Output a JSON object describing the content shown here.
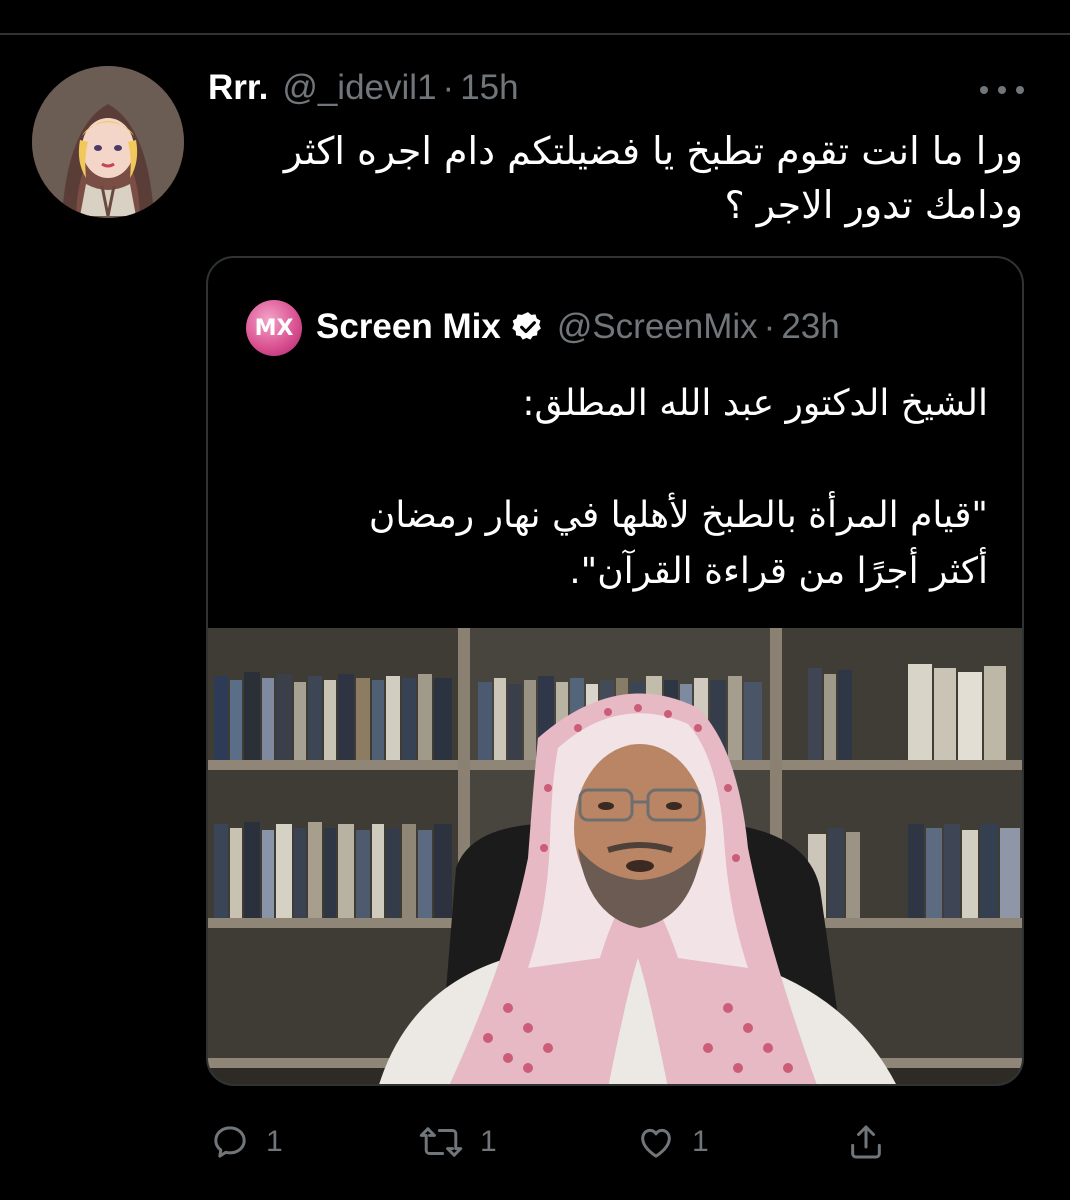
{
  "tweet": {
    "display_name": "Rrr.",
    "handle": "@_idevil1",
    "separator": "·",
    "time": "15h",
    "text_lines": [
      "ورا ما انت تقوم تطبخ يا فضيلتكم دام اجره اكثر",
      "ودامك تدور الاجر ؟"
    ],
    "avatar_icon": "cartoon-avatar",
    "more_icon": "more-horizontal-icon"
  },
  "quote": {
    "avatar_label": "MX",
    "display_name": "Screen Mix",
    "verified_icon": "verified-badge-icon",
    "handle": "@ScreenMix",
    "separator": "·",
    "time": "23h",
    "text_lines": [
      "الشيخ الدكتور عبد الله المطلق:",
      "",
      "\"قيام المرأة بالطبخ لأهلها في نهار رمضان",
      "أكثر أجرًا من قراءة القرآن\"."
    ],
    "image_icon": "photo-of-sheikh-in-library"
  },
  "actions": {
    "reply": {
      "icon": "reply-icon",
      "count": "1"
    },
    "retweet": {
      "icon": "retweet-icon",
      "count": "1"
    },
    "like": {
      "icon": "heart-icon",
      "count": "1"
    },
    "share": {
      "icon": "share-icon"
    }
  },
  "colors": {
    "background": "#000000",
    "primary_text": "#ffffff",
    "secondary_text": "#71767b",
    "border": "#2f3336",
    "verified_badge": "#ffffff"
  }
}
